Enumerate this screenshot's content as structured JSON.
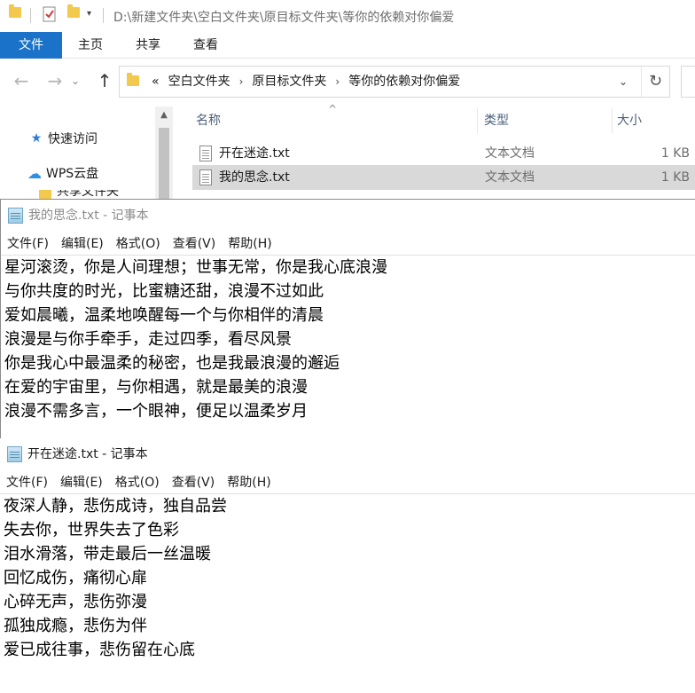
{
  "explorer": {
    "title_path": "D:\\新建文件夹\\空白文件夹\\原目标文件夹\\等你的依赖对你偏爱",
    "ribbon_tabs": [
      "文件",
      "主页",
      "共享",
      "查看"
    ],
    "nav": {
      "back_icon": "←",
      "forward_icon": "→",
      "up_icon": "↑"
    },
    "address": {
      "overflow": "«",
      "crumbs": [
        "空白文件夹",
        "原目标文件夹",
        "等你的依赖对你偏爱"
      ],
      "separator": "›",
      "dropdown_icon": "⌄",
      "refresh_icon": "↻"
    },
    "navpane": {
      "items": [
        {
          "label": "快速访问",
          "icon": "★"
        },
        {
          "label": "WPS云盘",
          "icon": "☁"
        },
        {
          "label": "共享文件夹",
          "icon": "folder"
        }
      ],
      "scroll_up_icon": "▲"
    },
    "columns": {
      "name": "名称",
      "type": "类型",
      "size": "大小",
      "sort_icon": "^"
    },
    "files": [
      {
        "name": "开在迷途.txt",
        "type": "文本文档",
        "size": "1 KB",
        "selected": false
      },
      {
        "name": "我的思念.txt",
        "type": "文本文档",
        "size": "1 KB",
        "selected": true
      }
    ],
    "colors": {
      "file_tab": "#1a73c8",
      "selection": "#d9d9d9",
      "folder": "#f2c94c"
    }
  },
  "notepad1": {
    "title": "我的思念.txt - 记事本",
    "menu": [
      "文件(F)",
      "编辑(E)",
      "格式(O)",
      "查看(V)",
      "帮助(H)"
    ],
    "lines": [
      "星河滚烫，你是人间理想；世事无常，你是我心底浪漫",
      "与你共度的时光，比蜜糖还甜，浪漫不过如此",
      "爱如晨曦，温柔地唤醒每一个与你相伴的清晨",
      "浪漫是与你手牵手，走过四季，看尽风景",
      "你是我心中最温柔的秘密，也是我最浪漫的邂逅",
      "在爱的宇宙里，与你相遇，就是最美的浪漫",
      "浪漫不需多言，一个眼神，便足以温柔岁月"
    ]
  },
  "notepad2": {
    "title": "开在迷途.txt - 记事本",
    "menu": [
      "文件(F)",
      "编辑(E)",
      "格式(O)",
      "查看(V)",
      "帮助(H)"
    ],
    "lines": [
      "夜深人静，悲伤成诗，独自品尝",
      "失去你，世界失去了色彩",
      "泪水滑落，带走最后一丝温暖",
      "回忆成伤，痛彻心扉",
      "心碎无声，悲伤弥漫",
      "孤独成瘾，悲伤为伴",
      "爱已成往事，悲伤留在心底"
    ]
  }
}
